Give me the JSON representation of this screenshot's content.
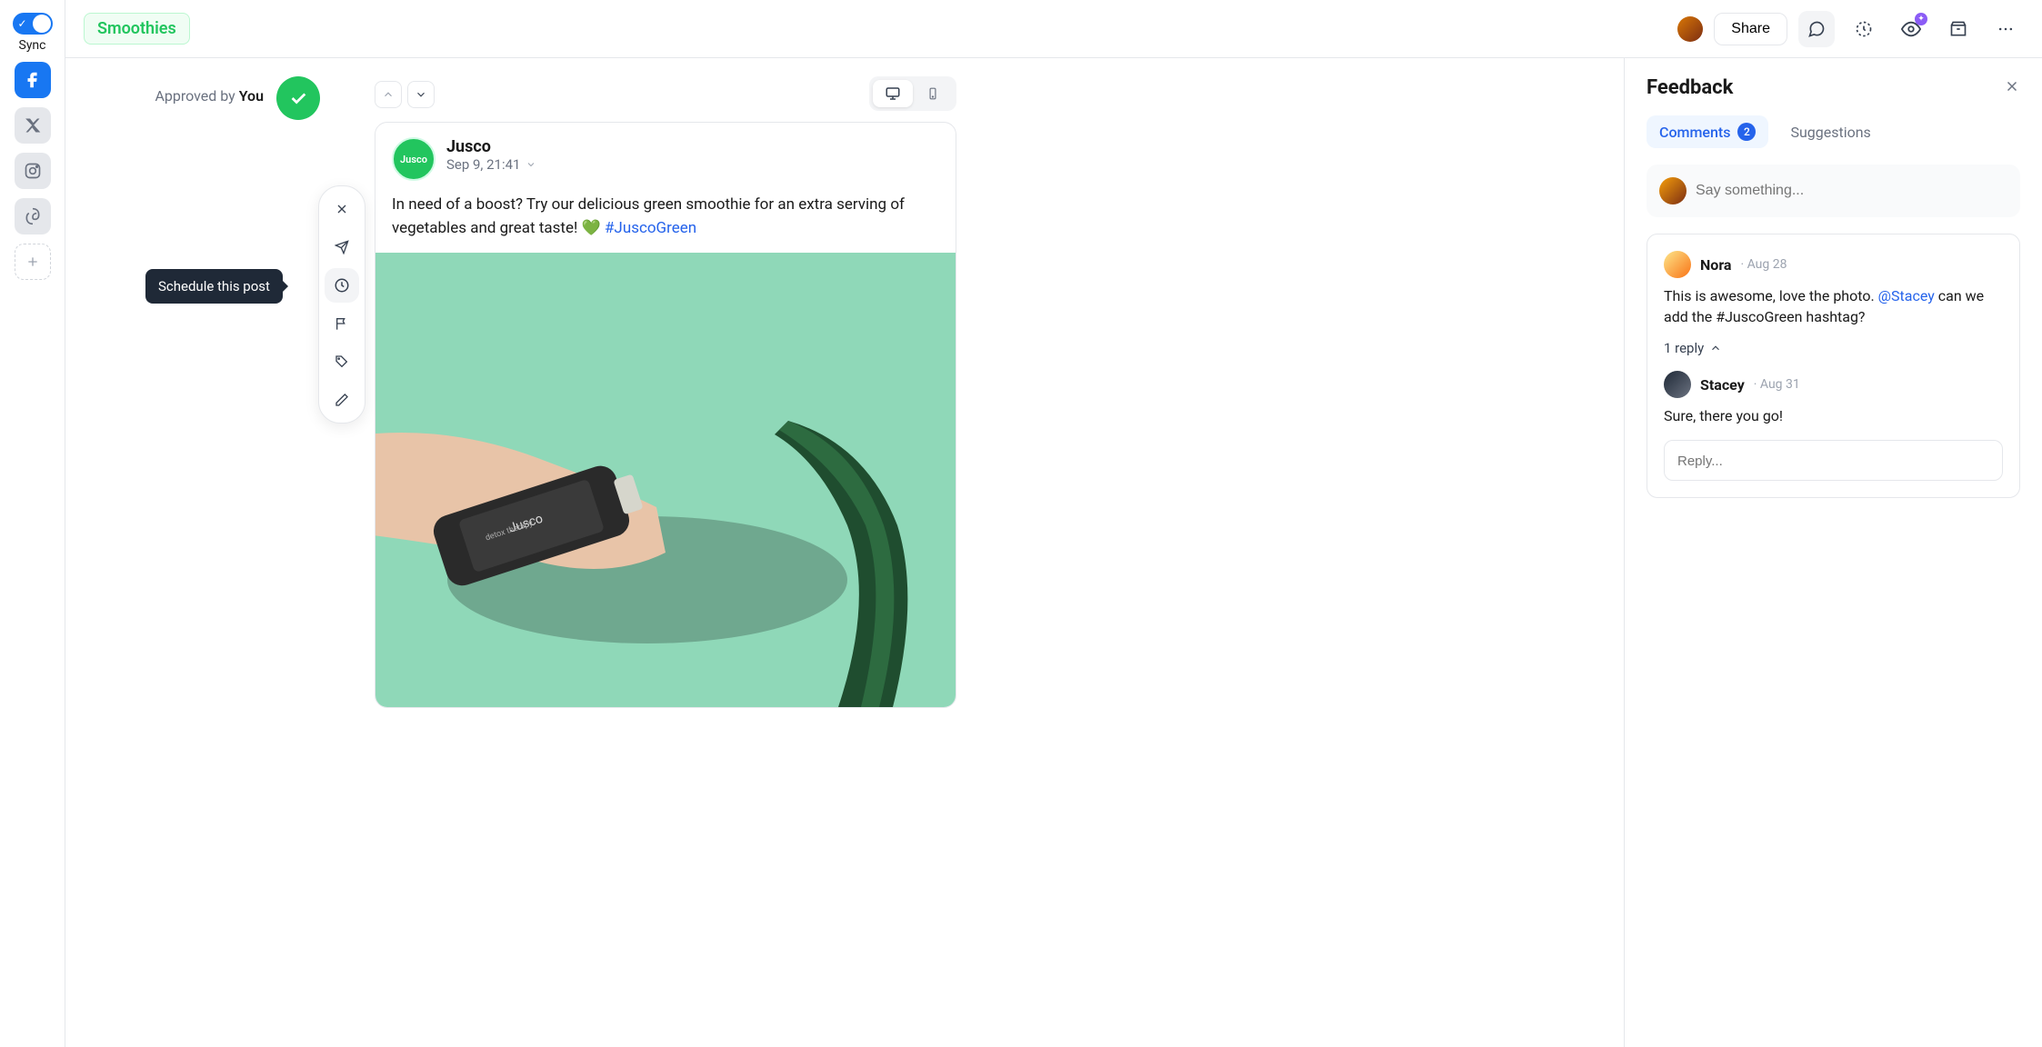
{
  "sync": {
    "label": "Sync",
    "enabled": true
  },
  "tag": "Smoothies",
  "topbar": {
    "share": "Share"
  },
  "approval": {
    "prefix": "Approved by ",
    "by": "You"
  },
  "tooltip": "Schedule this post",
  "post": {
    "name": "Jusco",
    "avatar_text": "Jusco",
    "date": "Sep 9, 21:41",
    "body_pre": "In need of a boost? Try our delicious green smoothie for an extra serving of vegetables and great taste! 💚 ",
    "hashtag": "#JuscoGreen"
  },
  "feedback": {
    "title": "Feedback",
    "tabs": {
      "comments": "Comments",
      "count": "2",
      "suggestions": "Suggestions"
    },
    "placeholder": "Say something...",
    "reply_placeholder": "Reply...",
    "reply_toggle": "1 reply",
    "comments": [
      {
        "name": "Nora",
        "date": "Aug 28",
        "body_pre": "This is awesome, love the photo. ",
        "mention": "@Stacey",
        "body_post": " can we add the #JuscoGreen hashtag?"
      },
      {
        "name": "Stacey",
        "date": "Aug 31",
        "body": "Sure, there you go!"
      }
    ]
  }
}
